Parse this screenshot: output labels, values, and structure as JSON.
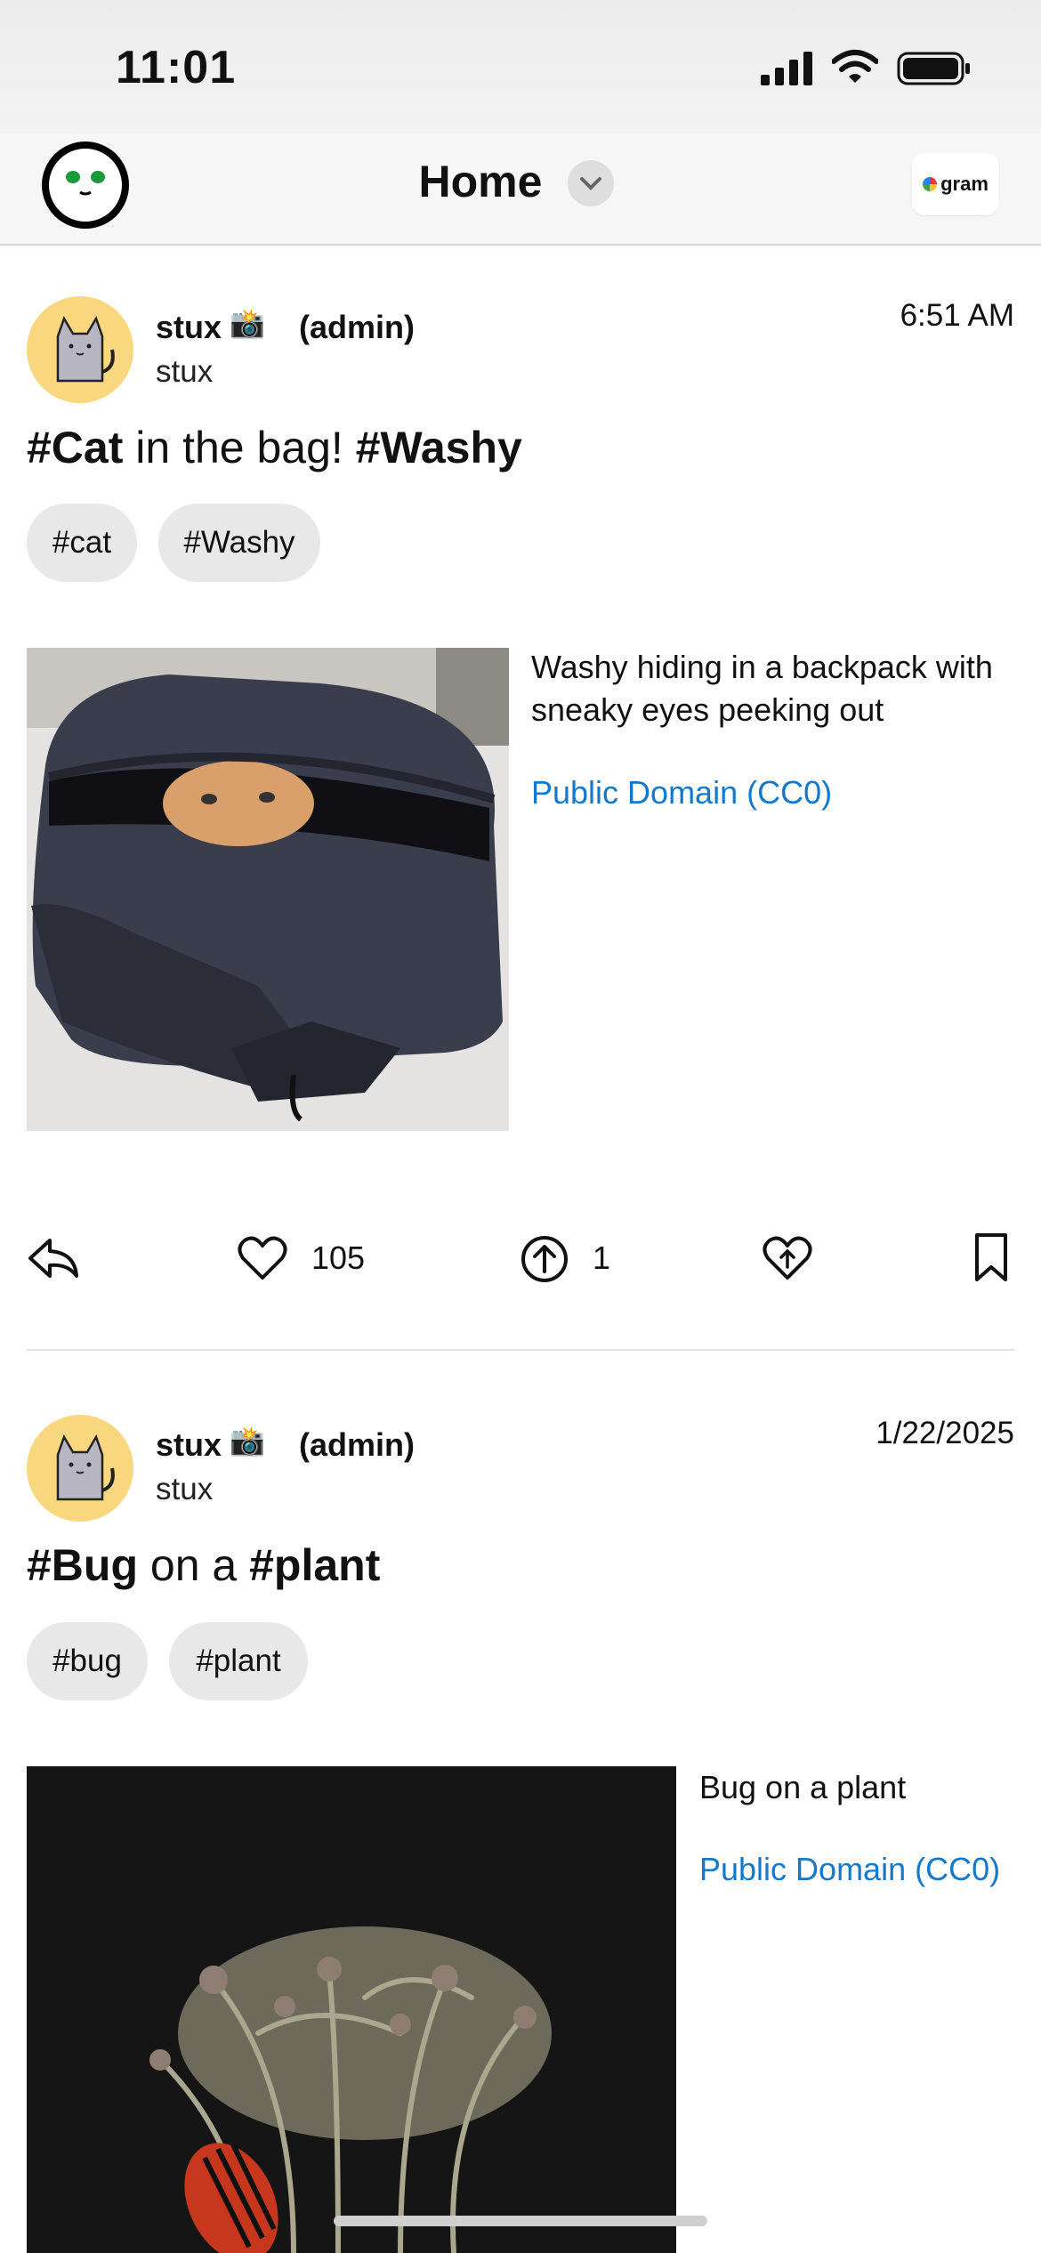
{
  "status_bar": {
    "time": "11:01"
  },
  "header": {
    "title": "Home",
    "logo_text": "gram"
  },
  "posts": [
    {
      "username": "stux",
      "role": "(admin)",
      "handle": "stux",
      "date": "6:51 AM",
      "title_parts": [
        "#Cat",
        " in the bag! ",
        "#Washy"
      ],
      "tags": [
        "#cat",
        "#Washy"
      ],
      "description": "Washy hiding in a backpack with sneaky eyes peeking out",
      "license": "Public Domain (CC0)",
      "likes": "105",
      "boosts": "1"
    },
    {
      "username": "stux",
      "role": "(admin)",
      "handle": "stux",
      "date": "1/22/2025",
      "title_parts": [
        "#Bug",
        " on a ",
        "#plant"
      ],
      "tags": [
        "#bug",
        "#plant"
      ],
      "description": "Bug on a plant",
      "license": "Public Domain (CC0)"
    }
  ],
  "icons": [
    "app-logo-icon",
    "chevron-down-icon",
    "signal-icon",
    "wifi-icon",
    "battery-icon",
    "reply-icon",
    "heart-icon",
    "boost-icon",
    "heart-badge-icon",
    "bookmark-icon",
    "camera-emoji-icon"
  ],
  "colors": {
    "link": "#1479cc",
    "avatar_bg": "#f9d77e",
    "tag_bg": "#e8e8e8"
  }
}
